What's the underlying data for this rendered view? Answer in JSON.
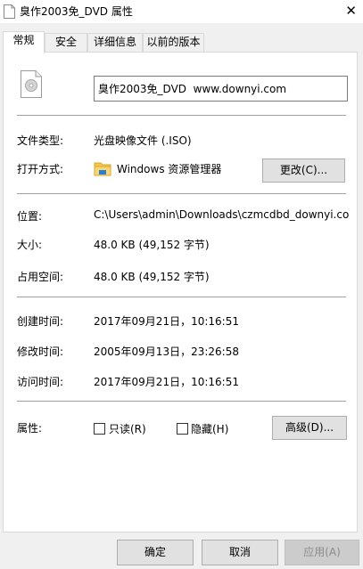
{
  "window": {
    "title": "臭作2003免_DVD 属性",
    "close_glyph": "✕"
  },
  "tabs": [
    {
      "label": "常规",
      "active": true
    },
    {
      "label": "安全",
      "active": false
    },
    {
      "label": "详细信息",
      "active": false
    },
    {
      "label": "以前的版本",
      "active": false
    }
  ],
  "general": {
    "file_name": "臭作2003免_DVD  www.downyi.com",
    "file_type_label": "文件类型:",
    "file_type_value": "光盘映像文件 (.ISO)",
    "opens_with_label": "打开方式:",
    "opens_with_value": "Windows 资源管理器",
    "change_button": "更改(C)...",
    "location_label": "位置:",
    "location_value": "C:\\Users\\admin\\Downloads\\czmcdbd_downyi.com",
    "size_label": "大小:",
    "size_value": "48.0 KB (49,152 字节)",
    "size_on_disk_label": "占用空间:",
    "size_on_disk_value": "48.0 KB (49,152 字节)",
    "created_label": "创建时间:",
    "created_value": "2017年09月21日，10:16:51",
    "modified_label": "修改时间:",
    "modified_value": "2005年09月13日，23:26:58",
    "accessed_label": "访问时间:",
    "accessed_value": "2017年09月21日，10:16:51",
    "attributes_label": "属性:",
    "readonly_label": "只读(R)",
    "hidden_label": "隐藏(H)",
    "advanced_button": "高级(D)..."
  },
  "footer": {
    "ok": "确定",
    "cancel": "取消",
    "apply": "应用(A)"
  },
  "icons": {
    "file": "disc-image-file-icon",
    "explorer": "folder-explorer-icon"
  }
}
